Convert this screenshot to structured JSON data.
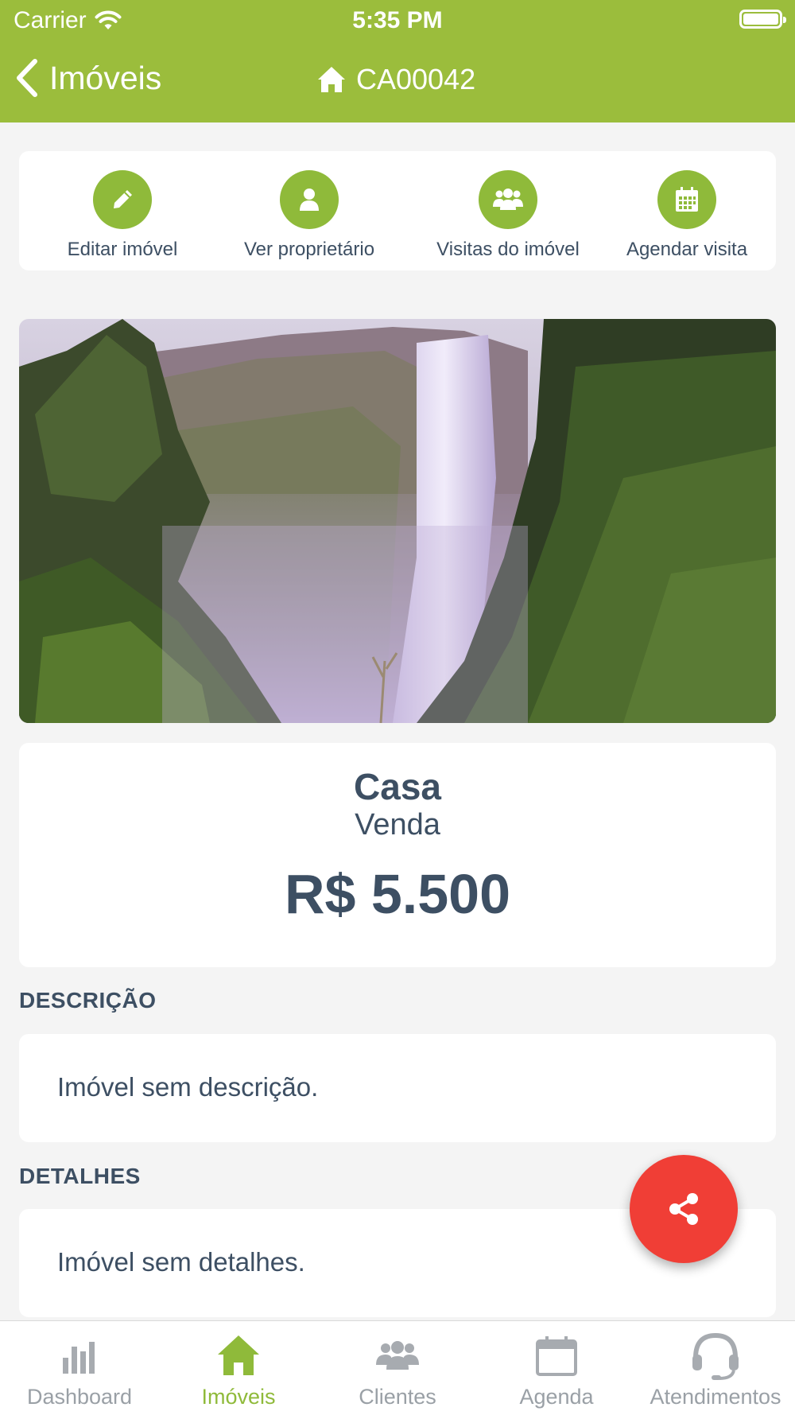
{
  "status_bar": {
    "carrier": "Carrier",
    "time": "5:35 PM"
  },
  "nav": {
    "back_label": "Imóveis",
    "title": "CA00042",
    "back_icon": "chevron-left-icon",
    "title_icon": "home-icon"
  },
  "actions": [
    {
      "label": "Editar imóvel",
      "icon": "pencil-icon"
    },
    {
      "label": "Ver proprietário",
      "icon": "user-icon"
    },
    {
      "label": "Visitas do imóvel",
      "icon": "users-icon"
    },
    {
      "label": "Agendar visita",
      "icon": "calendar-icon"
    }
  ],
  "property": {
    "type": "Casa",
    "purpose": "Venda",
    "price": "R$ 5.500"
  },
  "sections": {
    "description_title": "DESCRIÇÃO",
    "description_text": "Imóvel sem descrição.",
    "details_title": "DETALHES",
    "details_text": "Imóvel sem detalhes."
  },
  "fab": {
    "icon": "share-icon"
  },
  "tabs": [
    {
      "label": "Dashboard",
      "icon": "bar-chart-icon",
      "active": false
    },
    {
      "label": "Imóveis",
      "icon": "home-icon",
      "active": true
    },
    {
      "label": "Clientes",
      "icon": "users-icon",
      "active": false
    },
    {
      "label": "Agenda",
      "icon": "calendar-icon",
      "active": false
    },
    {
      "label": "Atendimentos",
      "icon": "headset-icon",
      "active": false
    }
  ],
  "colors": {
    "header": "#9bbd3c",
    "accent": "#8fba3a",
    "fab": "#f03e36",
    "text": "#3d4f63",
    "inactive_tab": "#9aa0a6",
    "background": "#f4f4f4"
  }
}
